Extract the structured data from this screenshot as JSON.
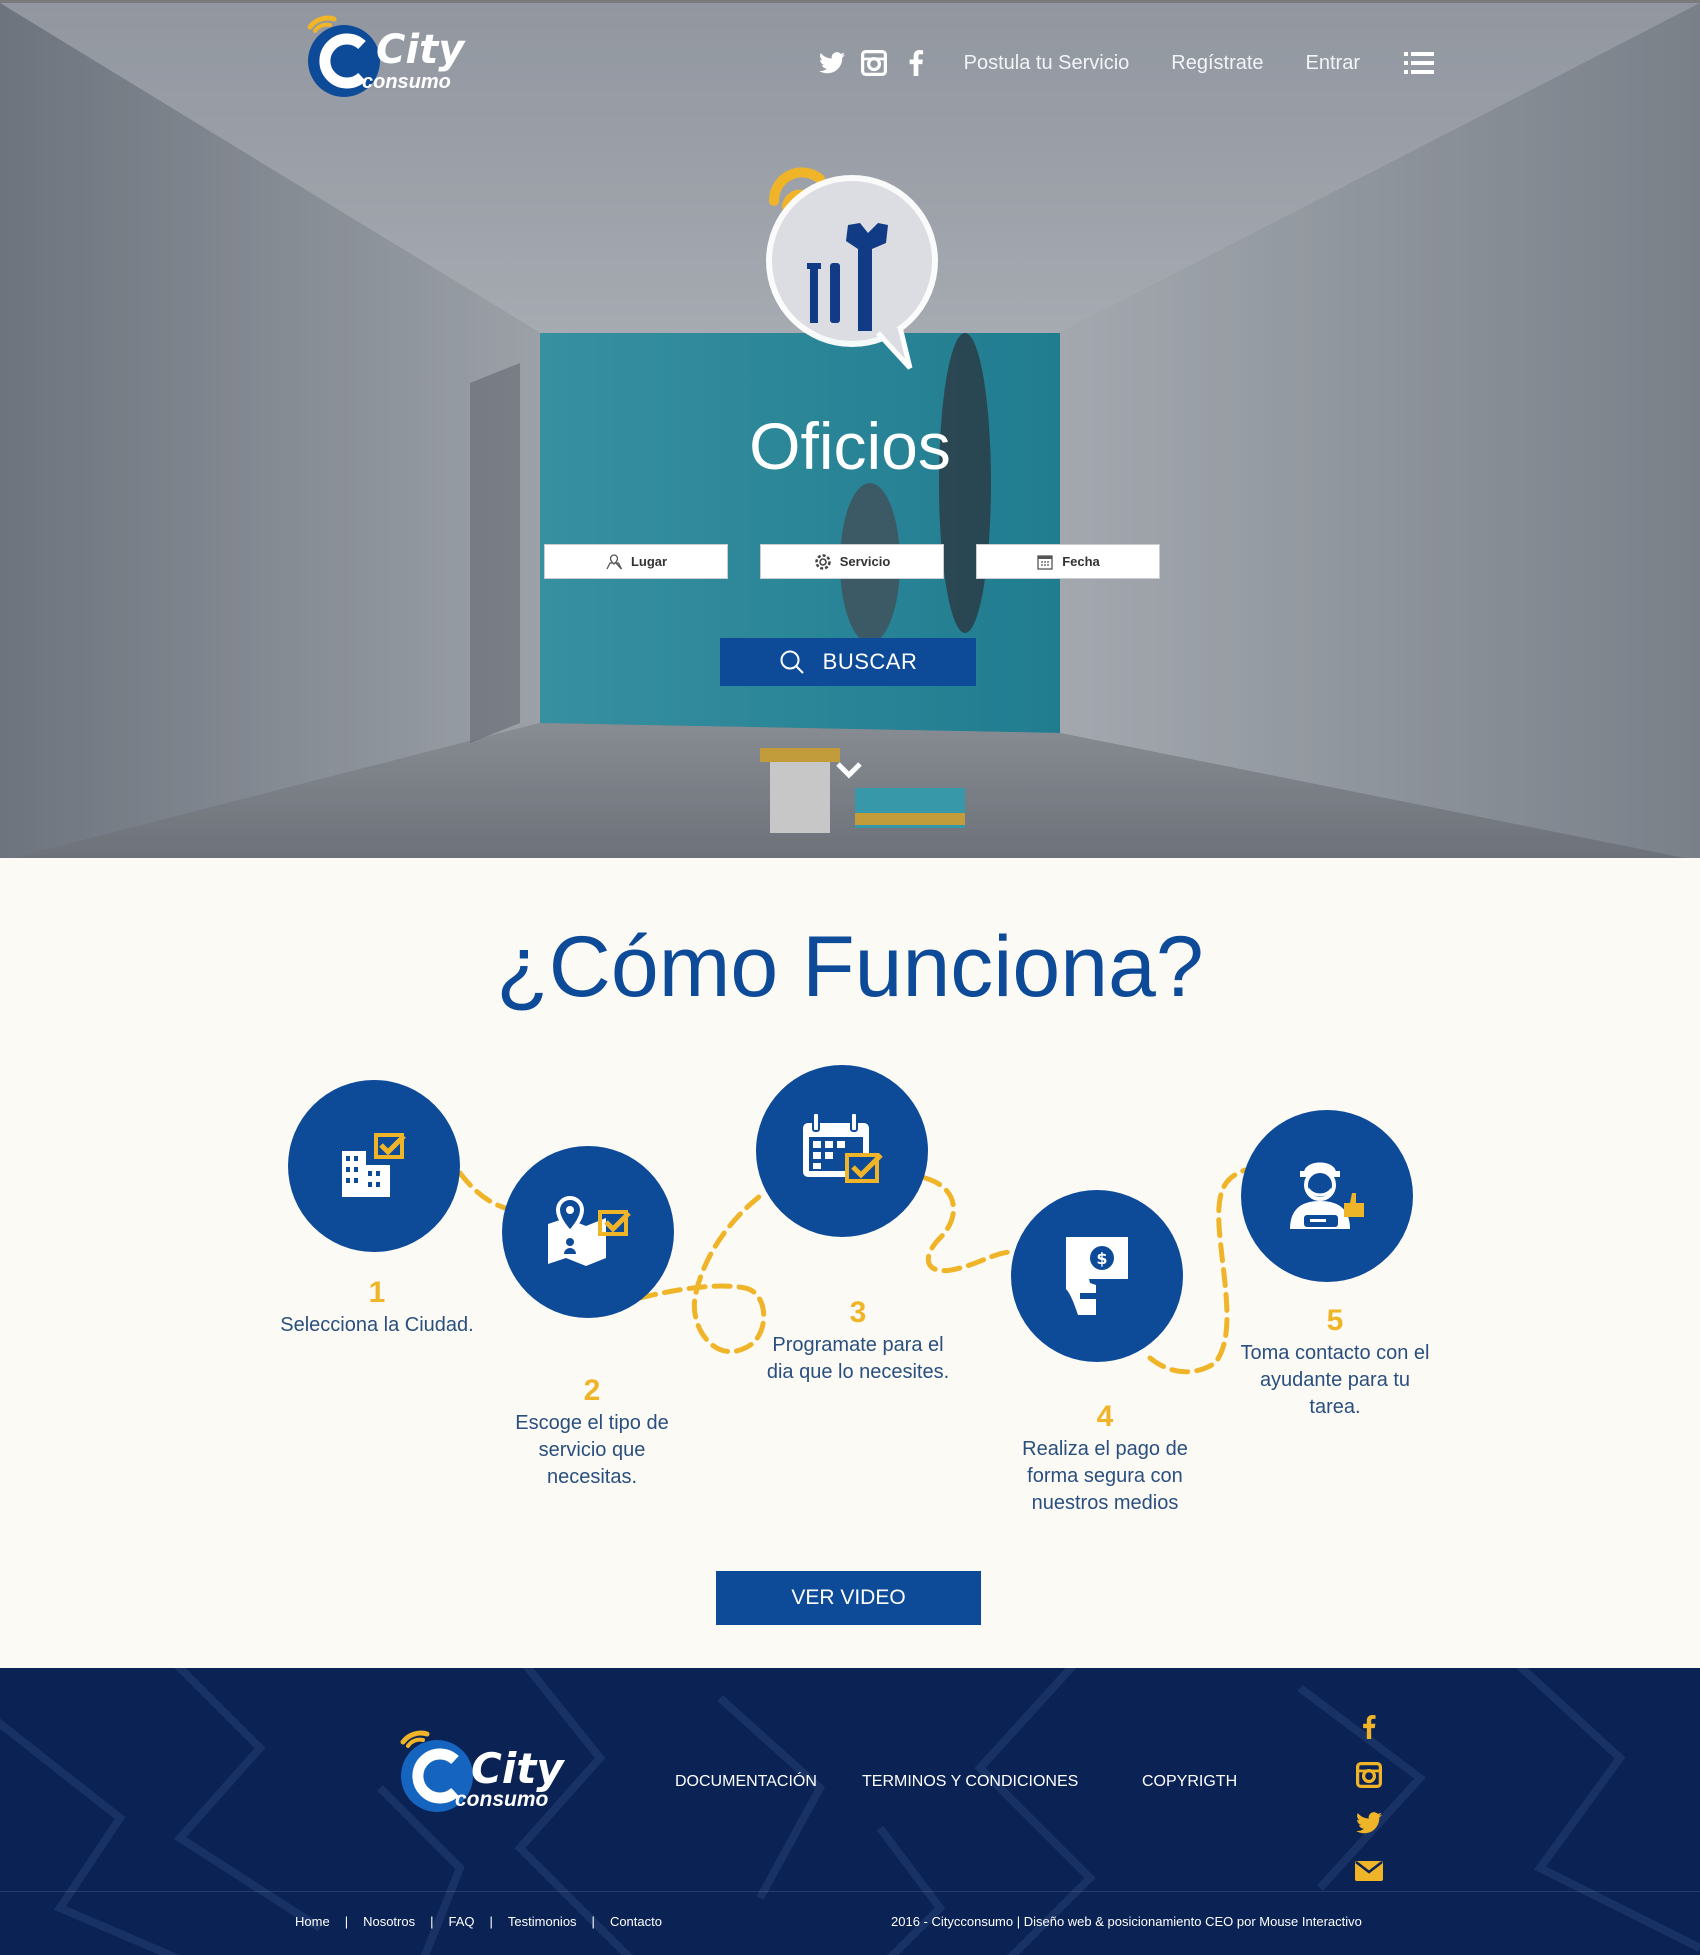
{
  "brand": {
    "name": "City",
    "sub": "consumo"
  },
  "nav": {
    "postula": "Postula tu Servicio",
    "registrate": "Regístrate",
    "entrar": "Entrar"
  },
  "hero": {
    "title": "Oficios",
    "fields": {
      "lugar": "Lugar",
      "servicio": "Servicio",
      "fecha": "Fecha"
    },
    "buscar": "BUSCAR"
  },
  "how": {
    "title": "¿Cómo Funciona?",
    "steps": [
      {
        "num": "1",
        "text": "Selecciona la Ciudad.",
        "icon": "buildings-check-icon"
      },
      {
        "num": "2",
        "text": "Escoge el tipo de servicio que necesitas.",
        "icon": "map-pin-check-icon"
      },
      {
        "num": "3",
        "text": "Programate para el dia que lo necesites.",
        "icon": "calendar-check-icon"
      },
      {
        "num": "4",
        "text": "Realiza el pago de forma segura con nuestros medios",
        "icon": "payment-hand-icon"
      },
      {
        "num": "5",
        "text": "Toma contacto con el ayudante para tu tarea.",
        "icon": "worker-thumbs-up-icon"
      }
    ],
    "video": "VER VIDEO"
  },
  "footer": {
    "documentacion": "DOCUMENTACIÓN",
    "terminos": "TERMINOS Y CONDICIONES",
    "copyright": "COPYRIGTH",
    "bottom_nav": [
      "Home",
      "Nosotros",
      "FAQ",
      "Testimonios",
      "Contacto"
    ],
    "copyline": "2016 - Citycconsumo | Diseño web & posicionamiento CEO  por Mouse Interactivo"
  },
  "colors": {
    "primary": "#0d4b99",
    "accent": "#f0b429",
    "footer": "#0b2354"
  }
}
